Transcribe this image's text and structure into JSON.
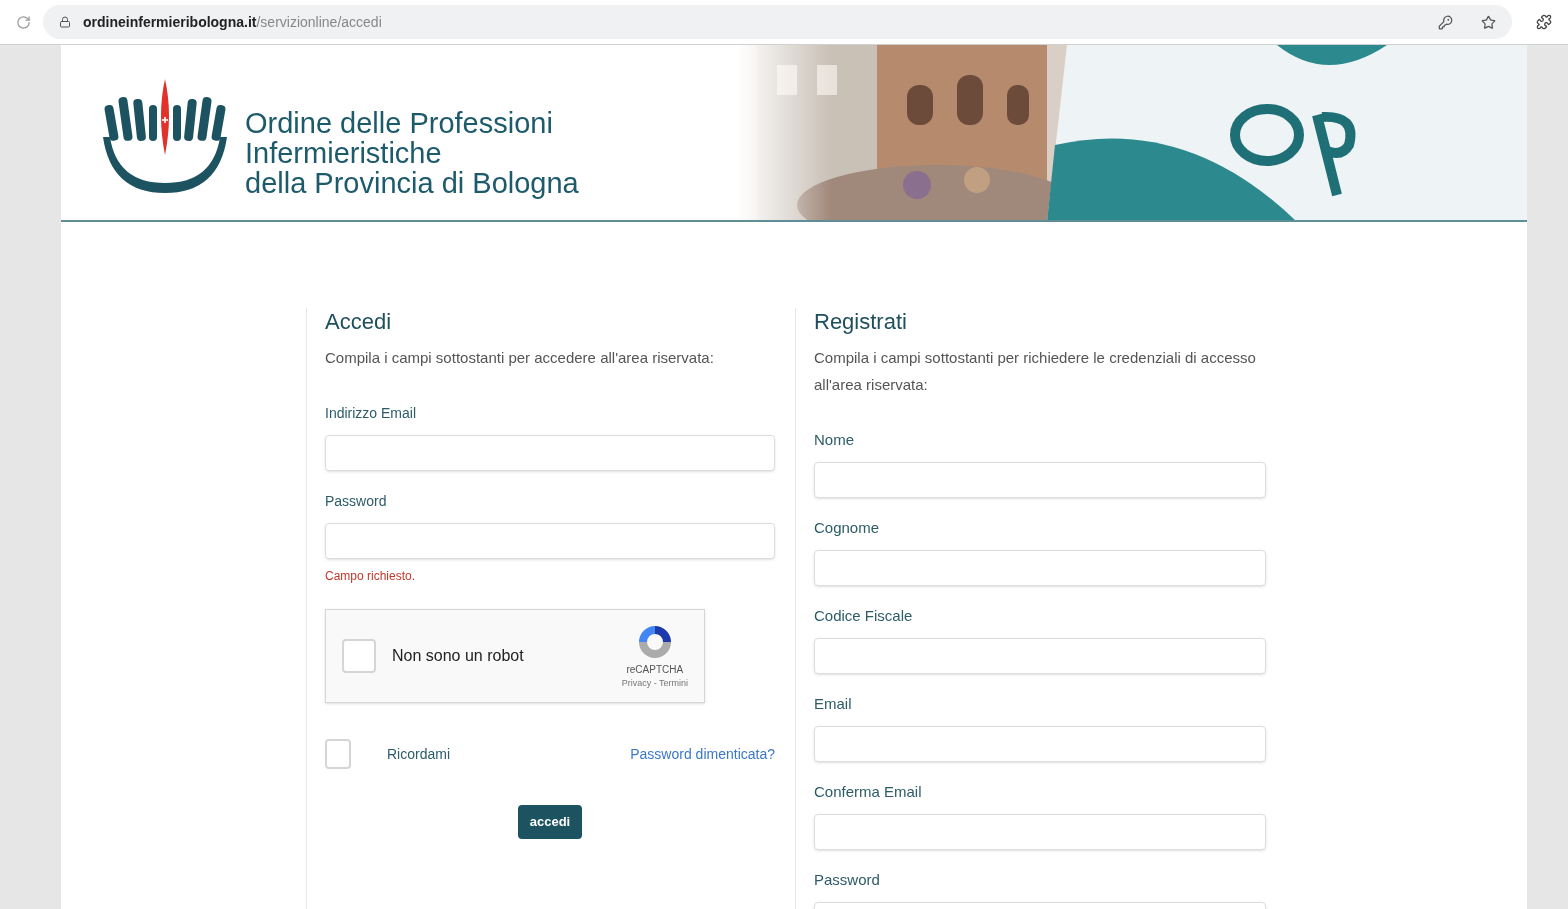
{
  "browser": {
    "url_host": "ordineinfermieribologna.it",
    "url_path": "/servizionline/accedi"
  },
  "header": {
    "title_lines": [
      "Ordine delle Professioni",
      "Infermieristiche",
      "della Provincia di Bologna"
    ]
  },
  "login": {
    "title": "Accedi",
    "description": "Compila i campi sottostanti per accedere all'area riservata:",
    "fields": [
      {
        "label": "Indirizzo Email"
      },
      {
        "label": "Password",
        "error": "Campo richiesto."
      }
    ],
    "captcha": {
      "label": "Non sono un robot",
      "checked": false,
      "brand": "reCAPTCHA",
      "links": "Privacy - Termini"
    },
    "remember": {
      "label": "Ricordami",
      "checked": false
    },
    "forgot_link": "Password dimenticata?",
    "submit": "accedi"
  },
  "register": {
    "title": "Registrati",
    "description": "Compila i campi sottostanti per richiedere le credenziali di accesso all'area riservata:",
    "fields": [
      {
        "label": "Nome"
      },
      {
        "label": "Cognome"
      },
      {
        "label": "Codice Fiscale"
      },
      {
        "label": "Email"
      },
      {
        "label": "Conferma Email"
      },
      {
        "label": "Password"
      }
    ]
  }
}
